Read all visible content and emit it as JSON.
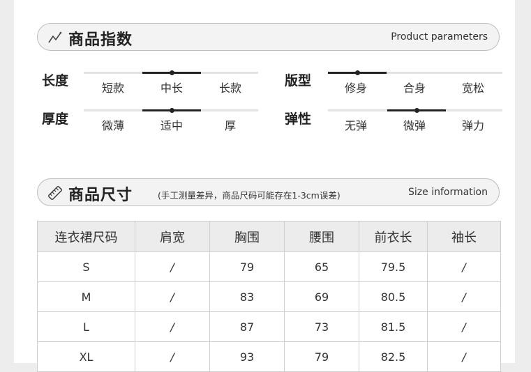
{
  "parameters": {
    "title": "商品指数",
    "subtitle": "Product parameters",
    "rows": [
      {
        "label": "长度",
        "options": [
          "短款",
          "中长",
          "长款"
        ],
        "selected": 1
      },
      {
        "label": "厚度",
        "options": [
          "微薄",
          "适中",
          "厚"
        ],
        "selected": 1
      },
      {
        "label": "版型",
        "options": [
          "修身",
          "合身",
          "宽松"
        ],
        "selected": 0
      },
      {
        "label": "弹性",
        "options": [
          "无弹",
          "微弹",
          "弹力"
        ],
        "selected": 1
      }
    ]
  },
  "size": {
    "title": "商品尺寸",
    "note": "(手工测量差异，商品尺码可能存在1-3cm误差)",
    "subtitle": "Size information",
    "headers": [
      "连衣裙尺码",
      "肩宽",
      "胸围",
      "腰围",
      "前衣长",
      "袖长"
    ],
    "rows": [
      [
        "S",
        "/",
        "79",
        "65",
        "79.5",
        "/"
      ],
      [
        "M",
        "/",
        "83",
        "69",
        "80.5",
        "/"
      ],
      [
        "L",
        "/",
        "87",
        "73",
        "81.5",
        "/"
      ],
      [
        "XL",
        "/",
        "93",
        "79",
        "82.5",
        "/"
      ]
    ]
  },
  "icons": {
    "parameters": "trend-line-icon",
    "size": "ruler-icon"
  }
}
